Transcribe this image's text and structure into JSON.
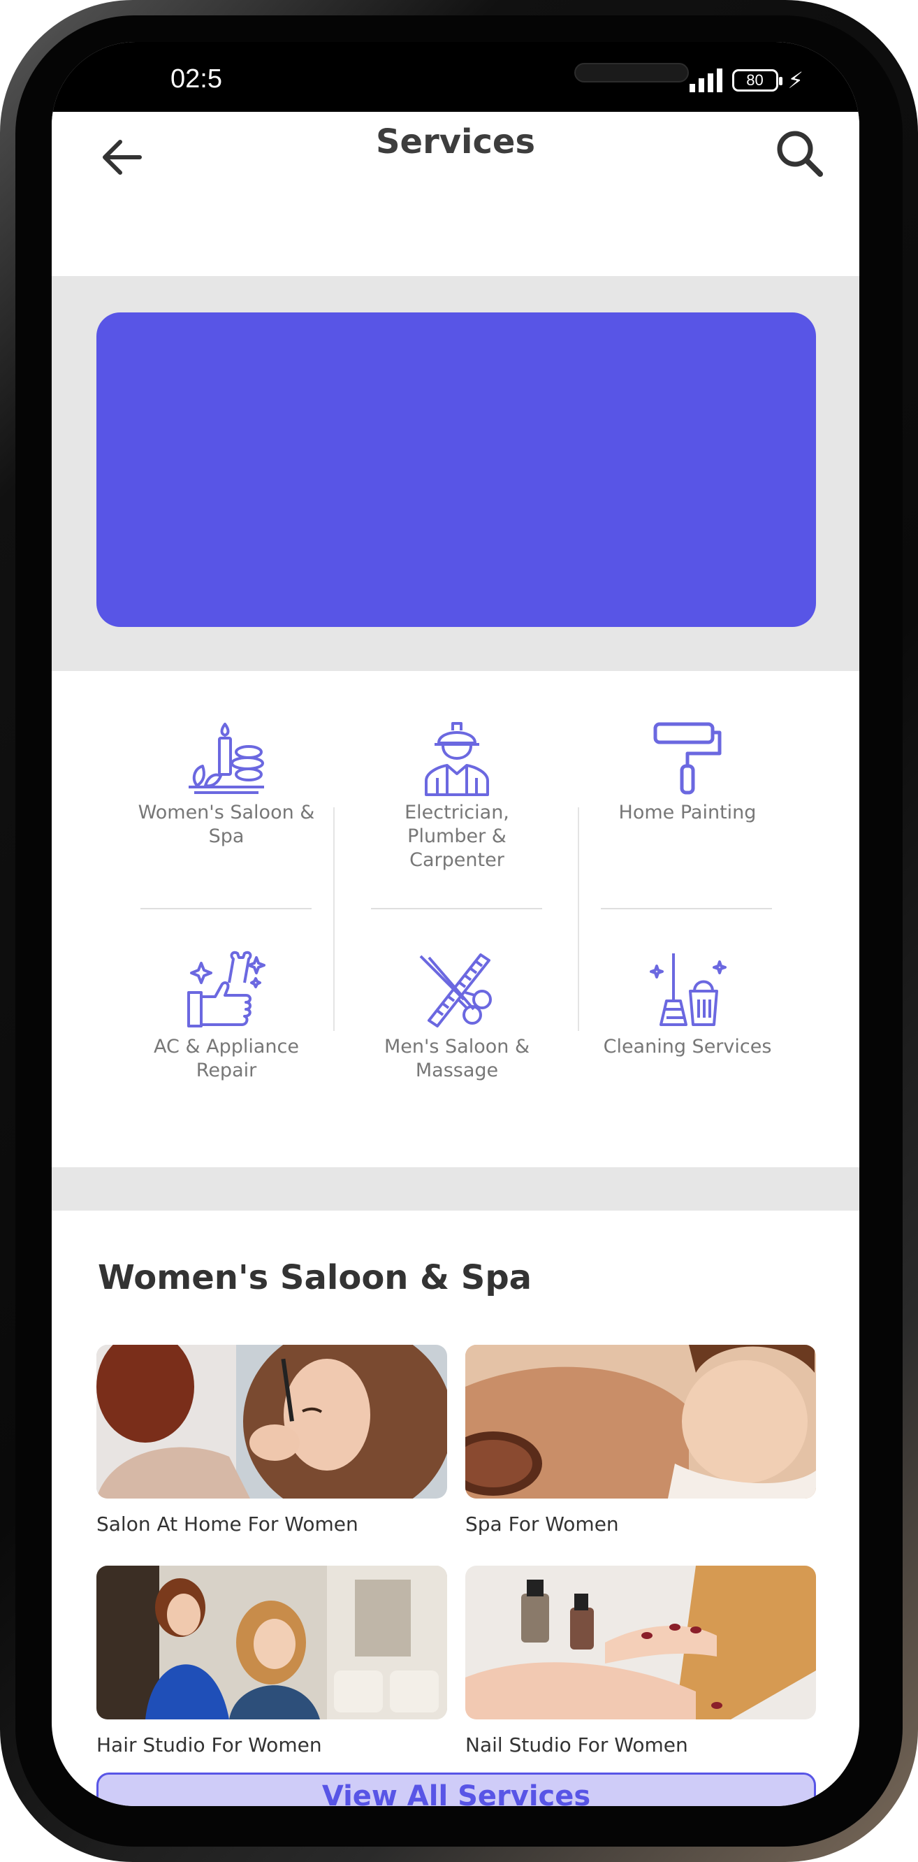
{
  "status": {
    "time": "02:5",
    "battery": "80",
    "network": "4G"
  },
  "header": {
    "title": "Services"
  },
  "categories": [
    {
      "label": "Women's Saloon & Spa",
      "icon": "spa-stones-icon"
    },
    {
      "label": "Electrician, Plumber & Carpenter",
      "icon": "worker-helmet-icon"
    },
    {
      "label": "Home Painting",
      "icon": "paint-roller-icon"
    },
    {
      "label": "AC & Appliance Repair",
      "icon": "repair-tools-icon"
    },
    {
      "label": "Men's Saloon & Massage",
      "icon": "scissors-comb-icon"
    },
    {
      "label": "Cleaning Services",
      "icon": "broom-bucket-icon"
    }
  ],
  "section": {
    "title": "Women's Saloon & Spa",
    "tiles": [
      {
        "caption": "Salon At Home For Women"
      },
      {
        "caption": "Spa For Women"
      },
      {
        "caption": "Hair Studio For Women"
      },
      {
        "caption": "Nail Studio For Women"
      }
    ],
    "view_all_label": "View All Services"
  },
  "colors": {
    "accent": "#5855e6",
    "icon": "#6b68e0",
    "band": "#e6e6e6"
  }
}
